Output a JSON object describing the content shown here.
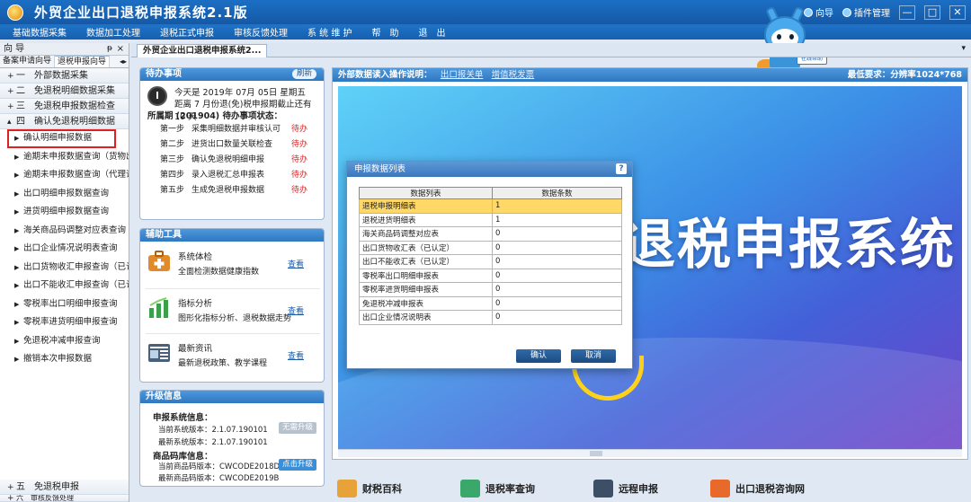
{
  "app": {
    "title": "外贸企业出口退税申报系统2.1版",
    "top_links": [
      "向导",
      "插件管理"
    ],
    "window_buttons": [
      "—",
      "□",
      "✕"
    ]
  },
  "mascot": {
    "sign": "在线帮助"
  },
  "menu": [
    "基础数据采集",
    "数据加工处理",
    "退税正式申报",
    "审核反馈处理",
    "系 统 维 护",
    "帮　助",
    "退　出"
  ],
  "left_panel": {
    "header": "向 导",
    "pin": "ᵽ",
    "close": "×",
    "tabs": [
      "备案申请向导",
      "退税申报向导"
    ],
    "active_tab": 1,
    "tab_arrows": "◂▸",
    "groups": [
      {
        "label": "一　外部数据采集",
        "expanded": false
      },
      {
        "label": "二　免退税明细数据采集",
        "expanded": false
      },
      {
        "label": "三　免退税申报数据检查",
        "expanded": false
      },
      {
        "label": "四　确认免退税明细数据",
        "expanded": true
      }
    ],
    "items": [
      "确认明细申报数据",
      "逾期未申报数据查询（货物出口",
      "逾期未申报数据查询（代理证明",
      "出口明细申报数据查询",
      "进货明细申报数据查询",
      "海关商品码调整对应表查询",
      "出口企业情况说明表查询",
      "出口货物收汇申报查询（已认定",
      "出口不能收汇申报查询（已认定",
      "零税率出口明细申报查询",
      "零税率进货明细申报查询",
      "免退税冲减申报查询",
      "撤销本次申报数据"
    ],
    "highlighted_item": 0,
    "bottom_groups": [
      "五　免退税申报",
      "六　审核反馈处理"
    ]
  },
  "main_tab": "外贸企业出口退税申报系统2...",
  "todo": {
    "title": "待办事项",
    "refresh": "刷新",
    "today": "今天是 2019年 07月 05日 星期五",
    "deadline": "距离 7 月份退(免)税申报期截止还有 10 天",
    "period": "所属期 (201904) 待办事项状态：",
    "steps": [
      {
        "step": "第一步",
        "name": "采集明细数据并审核认可",
        "status": "待办"
      },
      {
        "step": "第二步",
        "name": "进货出口数量关联检查",
        "status": "待办"
      },
      {
        "step": "第三步",
        "name": "确认免退税明细申报",
        "status": "待办"
      },
      {
        "step": "第四步",
        "name": "录入退税汇总申报表",
        "status": "待办"
      },
      {
        "step": "第五步",
        "name": "生成免退税申报数据",
        "status": "待办"
      }
    ]
  },
  "tools": {
    "title": "辅助工具",
    "items": [
      {
        "name": "系统体检",
        "desc": "全面检测数据健康指数",
        "link": "查看",
        "icon": "medical-kit-icon"
      },
      {
        "name": "指标分析",
        "desc": "图形化指标分析、退税数据走势",
        "link": "查看",
        "icon": "bar-chart-icon"
      },
      {
        "name": "最新资讯",
        "desc": "最新退税政策、教学课程",
        "link": "查看",
        "icon": "news-icon"
      }
    ]
  },
  "upgrade": {
    "title": "升级信息",
    "system_title": "申报系统信息：",
    "system_current": "当前系统版本：2.1.07.190101",
    "system_latest": "最新系统版本：2.1.07.190101",
    "system_btn": "无需升级",
    "code_title": "商品码库信息：",
    "code_current": "当前商品码版本：CWCODE2018D",
    "code_latest": "最新商品码版本：CWCODE2019B",
    "code_btn": "点击升级"
  },
  "banner": {
    "caption": "外部数据读入操作说明：",
    "link1": "出口报关单",
    "link2": "增值税发票",
    "requirement": "最低要求：分辨率1024*768",
    "big_text": "退税申报系统"
  },
  "dialog": {
    "title": "申报数据列表",
    "help": "?",
    "col_name": "数据列表",
    "col_count": "数据条数",
    "rows": [
      {
        "name": "退税申报明细表",
        "count": "1"
      },
      {
        "name": "退税进货明细表",
        "count": "1"
      },
      {
        "name": "海关商品码调整对应表",
        "count": "0"
      },
      {
        "name": "出口货物收汇表（已认定）",
        "count": "0"
      },
      {
        "name": "出口不能收汇表（已认定）",
        "count": "0"
      },
      {
        "name": "零税率出口明细申报表",
        "count": "0"
      },
      {
        "name": "零税率进货明细申报表",
        "count": "0"
      },
      {
        "name": "免退税冲减申报表",
        "count": "0"
      },
      {
        "name": "出口企业情况说明表",
        "count": "0"
      }
    ],
    "selected_row": 0,
    "confirm": "确认",
    "cancel": "取消"
  },
  "bottom_buttons": [
    {
      "label": "财税百科",
      "icon": "books-icon",
      "color": "#e7a23a"
    },
    {
      "label": "退税率查询",
      "icon": "magnifier-icon",
      "color": "#3aa86b"
    },
    {
      "label": "远程申报",
      "icon": "monitor-icon",
      "color": "#3d4f66"
    },
    {
      "label": "出口退税咨询网",
      "icon": "hand-icon",
      "color": "#e76a2a"
    }
  ],
  "colors": {
    "title_bar": "#1b6fc4",
    "card_header": "#2f78c2",
    "todo_status": "#e02020",
    "selected_row": "#ffd867",
    "highlight_box": "#e02020"
  }
}
